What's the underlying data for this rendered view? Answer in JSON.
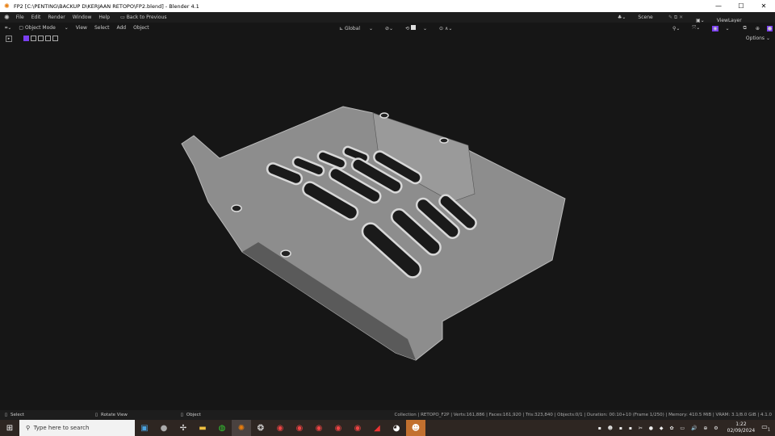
{
  "window": {
    "title": "FP2 [C:\\PENTING\\BACKUP D\\KERJAAN RETOPO\\FP2.blend] - Blender 4.1",
    "minimize": "—",
    "maximize": "☐",
    "close": "✕"
  },
  "menu": [
    "File",
    "Edit",
    "Render",
    "Window",
    "Help"
  ],
  "back_to_previous": "Back to Previous",
  "scene": "Scene",
  "view_layer": "ViewLayer",
  "header": {
    "mode": "Object Mode",
    "items": [
      "View",
      "Select",
      "Add",
      "Object"
    ],
    "orientation": "Global",
    "options": "Options"
  },
  "status": {
    "left": [
      "Select",
      "Rotate View",
      "Object"
    ],
    "stats": "Collection | RETOPO_F2P | Verts:161,886 | Faces:161,920 | Tris:323,840 | Objects:0/1 | Duration: 00:10+10 (Frame 1/250) | Memory: 410.5 MiB | VRAM: 3.1/8.0 GiB | 4.1.0"
  },
  "taskbar": {
    "search_placeholder": "Type here to search",
    "time": "1:22",
    "date": "02/09/2024",
    "notification_count": "1"
  },
  "colors": {
    "accent": "#7a3ff0",
    "viewport": "#161616",
    "mesh": "#8e8e8e"
  }
}
